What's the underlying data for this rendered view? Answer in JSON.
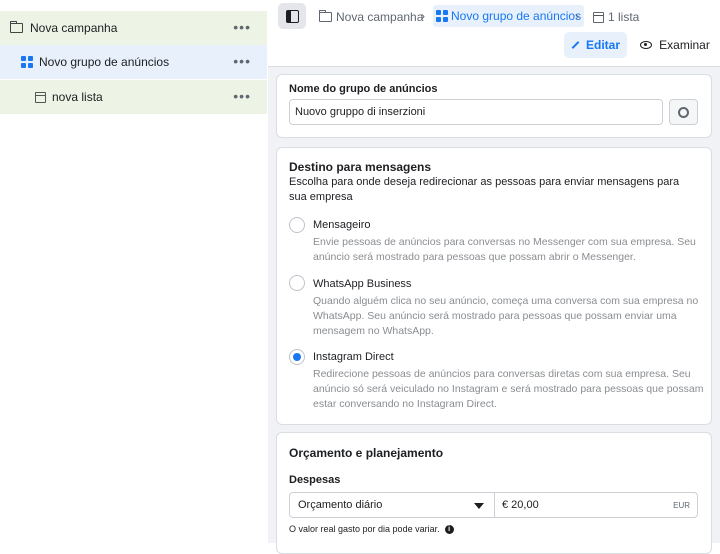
{
  "tree": {
    "items": [
      {
        "label": "Nova campanha",
        "icon": "folder-icon"
      },
      {
        "label": "Novo grupo de anúncios",
        "icon": "ad-set-grid-icon"
      },
      {
        "label": "nova lista",
        "icon": "ad-page-icon"
      }
    ],
    "more_label": "•••"
  },
  "breadcrumb": {
    "items": [
      "Nova campanha",
      "Novo grupo de anúncios",
      "1 lista"
    ],
    "separator": "›"
  },
  "toolbar": {
    "edit_label": "Editar",
    "view_label": "Examinar"
  },
  "adset_name": {
    "label": "Nome do grupo de anúncios",
    "value": "Nuovo gruppo di inserzioni"
  },
  "destination": {
    "title": "Destino para mensagens",
    "description": "Escolha para onde deseja redirecionar as pessoas para enviar mensagens para sua empresa",
    "options": [
      {
        "title": "Mensageiro",
        "description": "Envie pessoas de anúncios para conversas no Messenger com sua empresa. Seu anúncio será mostrado para pessoas que possam abrir o Messenger.",
        "selected": false
      },
      {
        "title": "WhatsApp Business",
        "description": "Quando alguém clica no seu anúncio, começa uma conversa com sua empresa no WhatsApp. Seu anúncio será mostrado para pessoas que possam enviar uma mensagem no WhatsApp.",
        "selected": false
      },
      {
        "title": "Instagram Direct",
        "description": "Redirecione pessoas de anúncios para conversas diretas com sua empresa. Seu anúncio só será veiculado no Instagram e será mostrado para pessoas que possam estar conversando no Instagram Direct.",
        "selected": true
      }
    ]
  },
  "budget": {
    "title": "Orçamento e planejamento",
    "spend_label": "Despesas",
    "budget_type": "Orçamento diário",
    "amount": "€ 20,00",
    "currency": "EUR",
    "note": "O valor real gasto por dia pode variar."
  },
  "colors": {
    "accent": "#1877f2",
    "active_bg": "#e7f0fb",
    "campaign_bg": "#eef4e5"
  }
}
